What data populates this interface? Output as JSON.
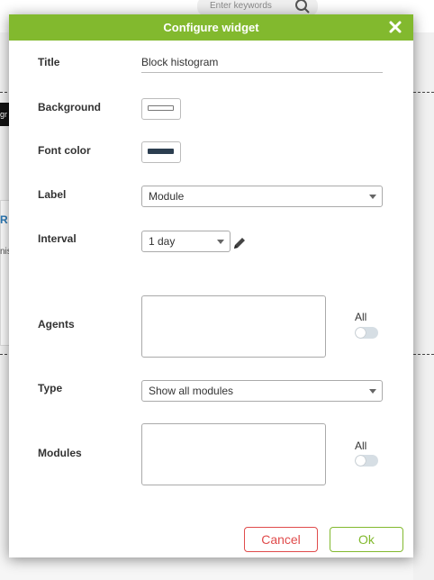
{
  "background_page": {
    "search_placeholder": "Enter keywords",
    "dark_chip_text": "gr",
    "card_letter": "R",
    "card_text": "nis"
  },
  "modal": {
    "title": "Configure widget",
    "fields": {
      "title_label": "Title",
      "title_value": "Block histogram",
      "background_label": "Background",
      "background_color": "#ffffff",
      "font_color_label": "Font color",
      "font_color": "#2c3e50",
      "label_label": "Label",
      "label_selected": "Module",
      "interval_label": "Interval",
      "interval_selected": "1 day",
      "agents_label": "Agents",
      "agents_all_label": "All",
      "type_label": "Type",
      "type_selected": "Show all modules",
      "modules_label": "Modules",
      "modules_all_label": "All"
    },
    "buttons": {
      "cancel": "Cancel",
      "ok": "Ok"
    }
  },
  "colors": {
    "header": "#82b92e",
    "cancel": "#e04c4c",
    "ok": "#82b92e"
  }
}
